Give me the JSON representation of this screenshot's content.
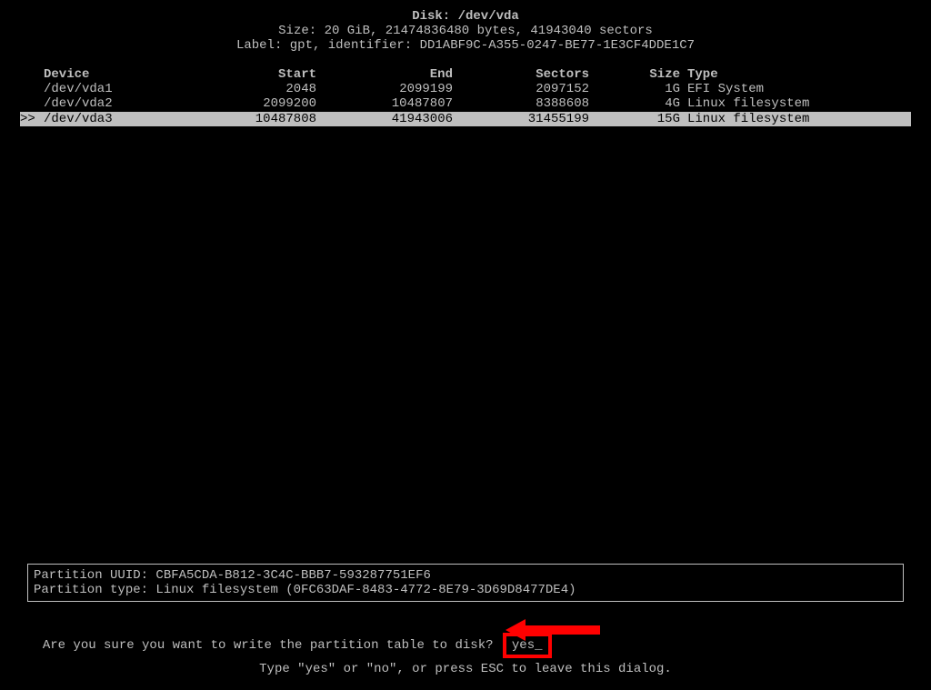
{
  "header": {
    "disk_label": "Disk: /dev/vda",
    "size_line": "Size: 20 GiB, 21474836480 bytes, 41943040 sectors",
    "label_line": "Label: gpt, identifier: DD1ABF9C-A355-0247-BE77-1E3CF4DDE1C7"
  },
  "columns": {
    "device": "Device",
    "start": "Start",
    "end": "End",
    "sectors": "Sectors",
    "size": "Size",
    "type": "Type"
  },
  "rows": [
    {
      "selected": false,
      "mark": "",
      "device": "/dev/vda1",
      "start": "2048",
      "end": "2099199",
      "sectors": "2097152",
      "size": "1G",
      "type": "EFI System"
    },
    {
      "selected": false,
      "mark": "",
      "device": "/dev/vda2",
      "start": "2099200",
      "end": "10487807",
      "sectors": "8388608",
      "size": "4G",
      "type": "Linux filesystem"
    },
    {
      "selected": true,
      "mark": ">>",
      "device": "/dev/vda3",
      "start": "10487808",
      "end": "41943006",
      "sectors": "31455199",
      "size": "15G",
      "type": "Linux filesystem"
    }
  ],
  "info": {
    "uuid_line": "Partition UUID: CBFA5CDA-B812-3C4C-BBB7-593287751EF6",
    "type_line": "Partition type: Linux filesystem (0FC63DAF-8483-4772-8E79-3D69D8477DE4)"
  },
  "prompt": {
    "question": "Are you sure you want to write the partition table to disk? ",
    "input_value": "yes_"
  },
  "hint": "Type \"yes\" or \"no\", or press ESC to leave this dialog."
}
